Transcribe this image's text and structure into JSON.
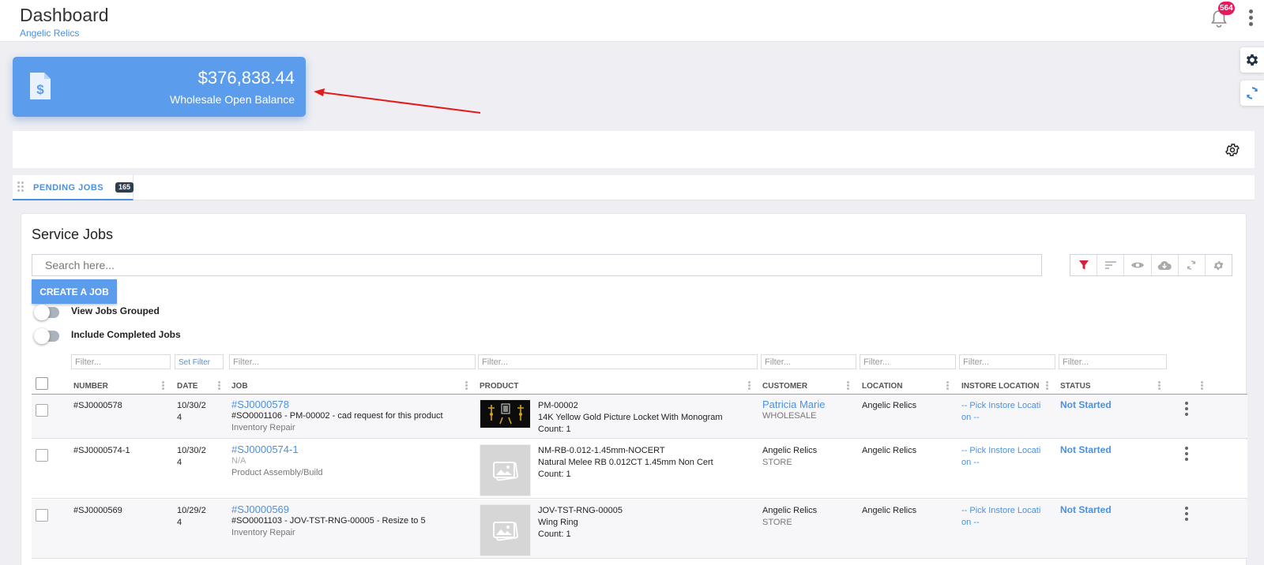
{
  "header": {
    "title": "Dashboard",
    "subtitle": "Angelic Relics",
    "notification_count": "564",
    "icons": [
      "bell-icon",
      "more-vertical-icon"
    ]
  },
  "side_actions": [
    "gear-icon",
    "sync-icon"
  ],
  "balance_card": {
    "amount": "$376,838.44",
    "label": "Wholesale Open Balance",
    "icon": "invoice-dollar-icon",
    "color": "#5b9cec"
  },
  "annotation": {
    "arrow_color": "#e31b1b"
  },
  "tabs": [
    {
      "label": "PENDING JOBS",
      "count": "165"
    }
  ],
  "panel": {
    "title": "Service Jobs",
    "search": {
      "placeholder": "Search here...",
      "value": ""
    },
    "tools": [
      "filter-icon",
      "sort-icon",
      "eye-icon",
      "cloud-download-icon",
      "refresh-icon",
      "settings-icon"
    ],
    "create_button": "CREATE A JOB",
    "toggles": [
      {
        "label": "View Jobs Grouped",
        "on": false
      },
      {
        "label": "Include Completed Jobs",
        "on": false
      }
    ],
    "filters": {
      "placeholder": "Filter...",
      "set_filter": "Set Filter"
    },
    "columns": [
      "NUMBER",
      "DATE",
      "JOB",
      "PRODUCT",
      "CUSTOMER",
      "LOCATION",
      "INSTORE LOCATION",
      "STATUS"
    ],
    "rows": [
      {
        "number": "#SJ0000578",
        "date_1": "10/30/2",
        "date_2": "4",
        "job_id": "#SJ0000578",
        "job_desc": "#SO0001106 - PM-00002 - cad request for this product",
        "job_type": "Inventory Repair",
        "product_code": "PM-00002",
        "product_name": "14K Yellow Gold Picture Locket With Monogram",
        "product_count": "Count: 1",
        "customer": "Patricia Marie",
        "customer_type": "WHOLESALE",
        "location": "Angelic Relics",
        "instore_1": "-- Pick Instore Locati",
        "instore_2": "on --",
        "status": "Not Started"
      },
      {
        "number": "#SJ0000574-1",
        "date_1": "10/30/2",
        "date_2": "4",
        "job_id": "#SJ0000574-1",
        "job_desc": "N/A",
        "job_type": "Product Assembly/Build",
        "product_code": "NM-RB-0.012-1.45mm-NOCERT",
        "product_name": "Natural Melee RB 0.012CT 1.45mm Non Cert",
        "product_count": "Count: 1",
        "customer": "Angelic Relics",
        "customer_type": "STORE",
        "location": "Angelic Relics",
        "instore_1": "-- Pick Instore Locati",
        "instore_2": "on --",
        "status": "Not Started"
      },
      {
        "number": "#SJ0000569",
        "date_1": "10/29/2",
        "date_2": "4",
        "job_id": "#SJ0000569",
        "job_desc": "#SO0001103 - JOV-TST-RNG-00005 - Resize to 5",
        "job_type": "Inventory Repair",
        "product_code": "JOV-TST-RNG-00005",
        "product_name": "Wing Ring",
        "product_count": "Count: 1",
        "customer": "Angelic Relics",
        "customer_type": "STORE",
        "location": "Angelic Relics",
        "instore_1": "-- Pick Instore Locati",
        "instore_2": "on --",
        "status": "Not Started"
      }
    ]
  }
}
